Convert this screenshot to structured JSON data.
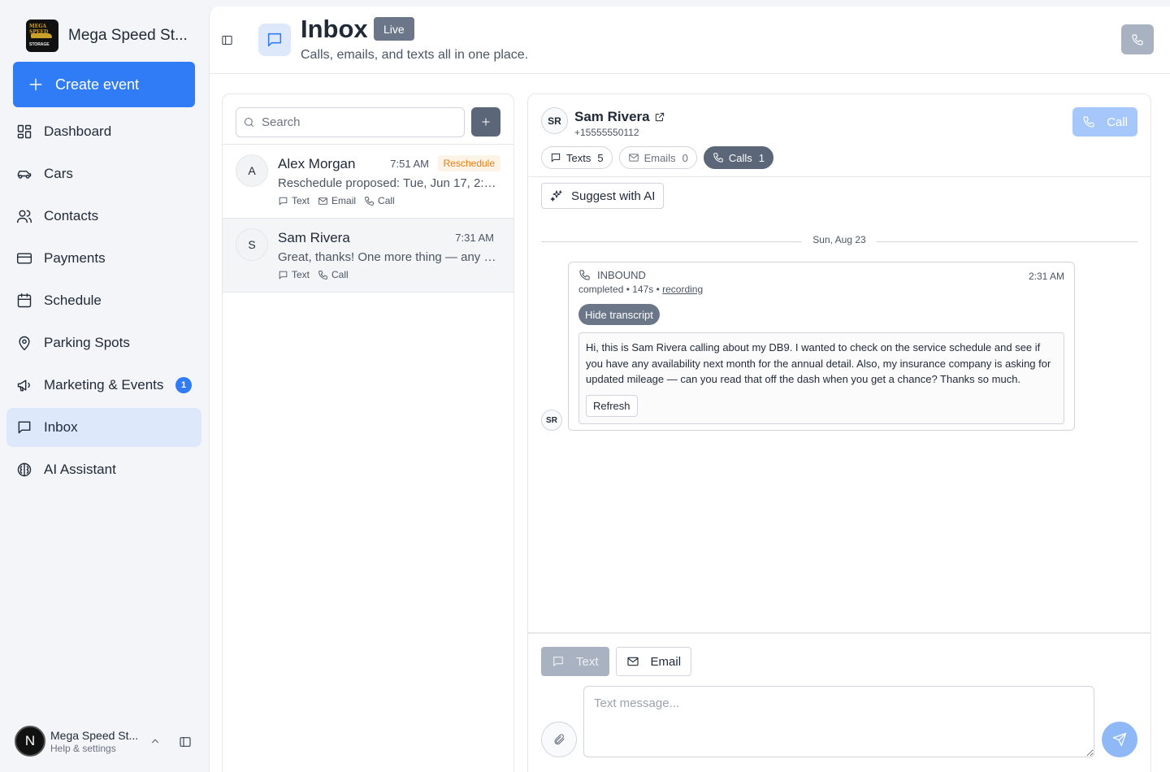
{
  "brand": {
    "name": "Mega Speed St...",
    "logo_text_top": "MEGA SPEED",
    "logo_text_bottom": "STORAGE"
  },
  "sidebar": {
    "create_label": "Create event",
    "items": [
      {
        "label": "Dashboard",
        "icon": "dashboard-icon"
      },
      {
        "label": "Cars",
        "icon": "car-icon"
      },
      {
        "label": "Contacts",
        "icon": "users-icon"
      },
      {
        "label": "Payments",
        "icon": "credit-card-icon"
      },
      {
        "label": "Schedule",
        "icon": "calendar-icon"
      },
      {
        "label": "Parking Spots",
        "icon": "map-pin-icon"
      },
      {
        "label": "Marketing & Events",
        "icon": "megaphone-icon",
        "badge": "1"
      },
      {
        "label": "Inbox",
        "icon": "message-square-icon",
        "active": true
      },
      {
        "label": "AI Assistant",
        "icon": "brain-icon"
      }
    ],
    "user": {
      "initial": "N",
      "name": "Mega Speed St...",
      "sub": "Help & settings"
    }
  },
  "header": {
    "title": "Inbox",
    "badge": "Live",
    "subtitle": "Calls, emails, and texts all in one place."
  },
  "list": {
    "search_placeholder": "Search",
    "conversations": [
      {
        "initial": "A",
        "name": "Alex Morgan",
        "time": "7:51 AM",
        "tag": "Reschedule",
        "preview": "Reschedule proposed: Tue, Jun 17, 2:00 ...",
        "channels": [
          "Text",
          "Email",
          "Call"
        ]
      },
      {
        "initial": "S",
        "name": "Sam Rivera",
        "time": "7:31 AM",
        "preview": "Great, thanks! One more thing — any u...",
        "channels": [
          "Text",
          "Call"
        ],
        "selected": true
      }
    ]
  },
  "detail": {
    "initials": "SR",
    "name": "Sam Rivera",
    "phone": "+15555550112",
    "call_label": "Call",
    "filters": [
      {
        "label": "Texts",
        "count": "5"
      },
      {
        "label": "Emails",
        "count": "0"
      },
      {
        "label": "Calls",
        "count": "1"
      }
    ],
    "suggest_label": "Suggest with AI",
    "day_label": "Sun, Aug 23",
    "call": {
      "direction": "INBOUND",
      "time": "2:31 AM",
      "meta_prefix": "completed • 147s • ",
      "recording_label": "recording",
      "hide_label": "Hide transcript",
      "transcript": "Hi, this is Sam Rivera calling about my DB9. I wanted to check on the service schedule and see if you have any availability next month for the annual detail. Also, my insurance company is asking for updated mileage — can you read that off the dash when you get a chance? Thanks so much.",
      "refresh_label": "Refresh"
    },
    "composer": {
      "tabs": [
        "Text",
        "Email"
      ],
      "placeholder": "Text message..."
    }
  },
  "colors": {
    "accent": "#2f7cf6",
    "active_nav": "#dde8fb",
    "slate": "#5b6678",
    "tag_orange": "#ea7c0c"
  }
}
